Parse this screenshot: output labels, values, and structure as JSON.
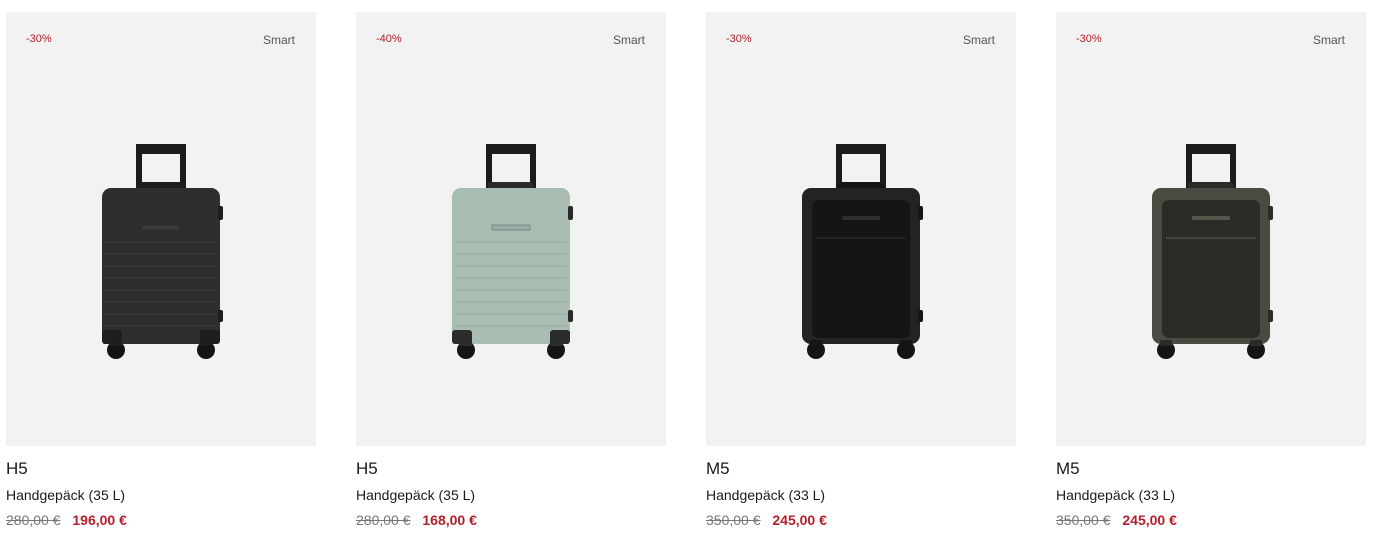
{
  "products": [
    {
      "discount": "-30%",
      "tag": "Smart",
      "model": "H5",
      "description": "Handgepäck (35 L)",
      "old_price": "280,00 €",
      "new_price": "196,00 €",
      "style": "hardshell",
      "colors": {
        "body": "#2e2e2f",
        "rib": "#3a3a3b",
        "accent": "#1e1e1f"
      }
    },
    {
      "discount": "-40%",
      "tag": "Smart",
      "model": "H5",
      "description": "Handgepäck (35 L)",
      "old_price": "280,00 €",
      "new_price": "168,00 €",
      "style": "hardshell",
      "colors": {
        "body": "#a9bdb3",
        "rib": "#9bb0a5",
        "accent": "#2b2b2b"
      }
    },
    {
      "discount": "-30%",
      "tag": "Smart",
      "model": "M5",
      "description": "Handgepäck (33 L)",
      "old_price": "350,00 €",
      "new_price": "245,00 €",
      "style": "frontpocket",
      "colors": {
        "body": "#232324",
        "rib": "#2e2e2f",
        "accent": "#151516"
      }
    },
    {
      "discount": "-30%",
      "tag": "Smart",
      "model": "M5",
      "description": "Handgepäck (33 L)",
      "old_price": "350,00 €",
      "new_price": "245,00 €",
      "style": "frontpocket",
      "colors": {
        "body": "#4a4a42",
        "rib": "#55554c",
        "accent": "#2a2a26"
      }
    }
  ]
}
